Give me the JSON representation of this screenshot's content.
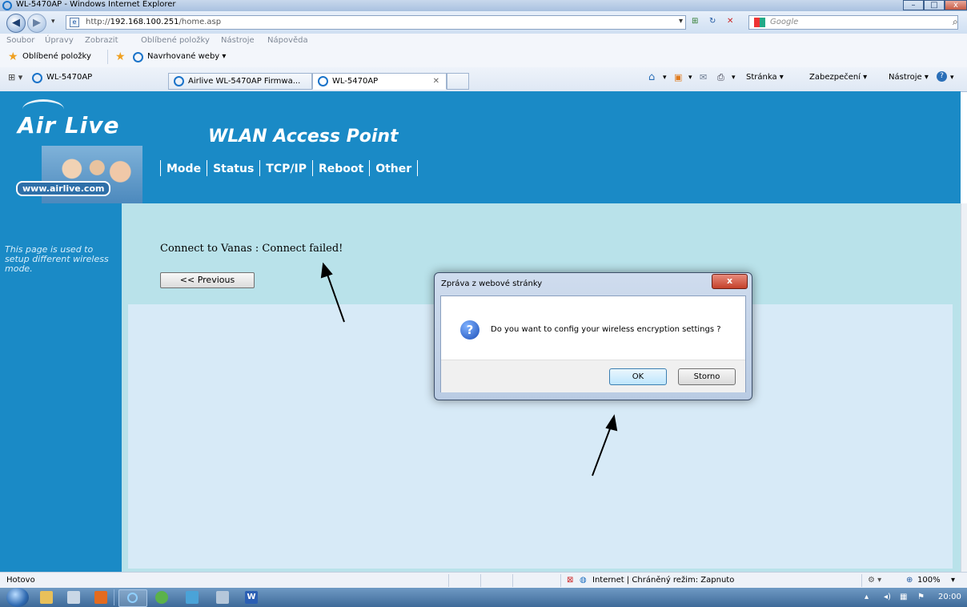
{
  "window": {
    "title": "WL-5470AP - Windows Internet Explorer"
  },
  "address": {
    "url_prefix": "http://",
    "url_host": "192.168.100.251",
    "url_path": "/home.asp"
  },
  "search": {
    "placeholder": "Google"
  },
  "menu": [
    "Soubor",
    "Úpravy",
    "Zobrazit",
    "Oblíbené položky",
    "Nástroje",
    "Nápověda"
  ],
  "favorites": {
    "label": "Oblíbené položky",
    "suggested": "Navrhované weby ▾"
  },
  "tabs": [
    {
      "label": "WL-5470AP"
    },
    {
      "label": "Airlive WL-5470AP Firmwa..."
    },
    {
      "label": "WL-5470AP"
    }
  ],
  "commands": {
    "page": "Stránka ▾",
    "security": "Zabezpečení ▾",
    "tools": "Nástroje ▾"
  },
  "site": {
    "logo": "Air Live",
    "website_badge": "www.airlive.com",
    "title": "WLAN Access Point",
    "nav": [
      "Mode",
      "Status",
      "TCP/IP",
      "Reboot",
      "Other"
    ],
    "sidebar_text": "This page is used to setup different wireless mode.",
    "message": "Connect to Vanas : Connect failed!",
    "previous_button": "<< Previous"
  },
  "dialog": {
    "title": "Zpráva z webové stránky",
    "question": "Do you want to config your wireless encryption settings ?",
    "ok": "OK",
    "cancel": "Storno"
  },
  "statusbar": {
    "left": "Hotovo",
    "zone": "Internet | Chráněný režim: Zapnuto",
    "zoom": "100%"
  },
  "taskbar": {
    "clock": "20:00"
  },
  "colors": {
    "header_blue": "#1a8ac6",
    "content_teal": "#b9e2ea",
    "content_inner": "#d7eaf7"
  }
}
